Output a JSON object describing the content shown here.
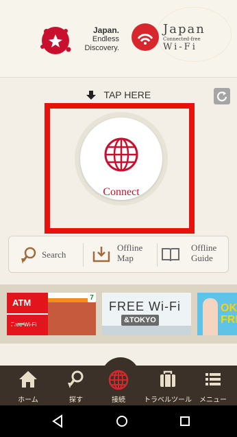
{
  "header": {
    "japan_logo": {
      "line1": "Japan.",
      "line2": "Endless",
      "line3": "Discovery."
    },
    "wifi_logo": {
      "line1": "Japan",
      "line2": "Connected-free",
      "line3": "Wi-Fi"
    }
  },
  "tap_here": "TAP HERE",
  "connect": {
    "label": "Connect",
    "accent": "#c8102e"
  },
  "tools": [
    {
      "label": "Search",
      "icon": "search-pin-icon"
    },
    {
      "label1": "Offline",
      "label2": "Map",
      "icon": "download-map-icon"
    },
    {
      "label1": "Offline",
      "label2": "Guide",
      "icon": "book-icon"
    }
  ],
  "banners": {
    "atm": {
      "title": "ATM",
      "sub": "Free Wi-Fi",
      "seven": "7"
    },
    "tokyo": {
      "title": "FREE Wi-Fi",
      "sub": "&TOKYO"
    },
    "ok": {
      "text1": "OK",
      "text2": "FRI"
    }
  },
  "tabbar": [
    {
      "label": "ホーム",
      "icon": "home-icon"
    },
    {
      "label": "探す",
      "icon": "search-pin-icon"
    },
    {
      "label": "接続",
      "icon": "globe-icon"
    },
    {
      "label": "トラベルツール",
      "icon": "suitcase-icon"
    },
    {
      "label": "メニュー",
      "icon": "menu-icon"
    }
  ],
  "colors": {
    "brand_red": "#e8120c",
    "tabbar": "#3b3129"
  }
}
